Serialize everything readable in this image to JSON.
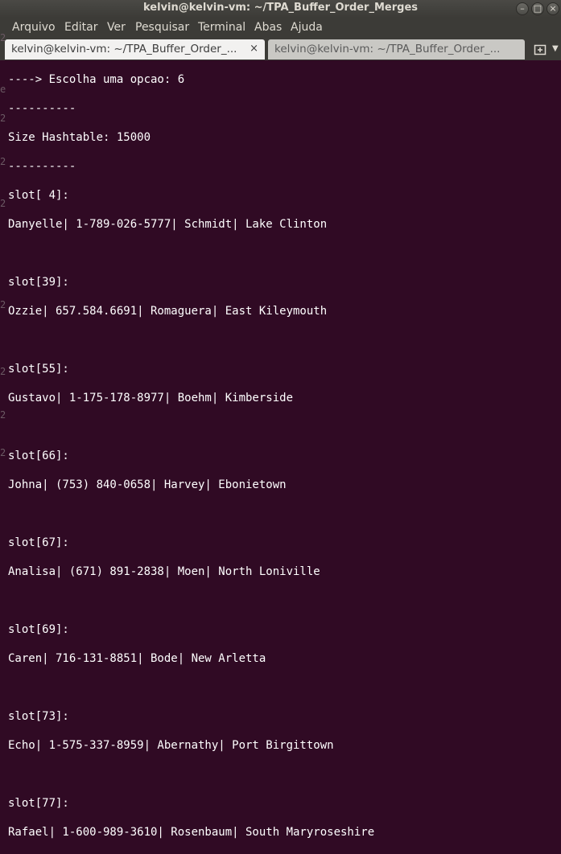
{
  "window": {
    "title": "kelvin@kelvin-vm: ~/TPA_Buffer_Order_Merges",
    "minimize_glyph": "–",
    "maximize_glyph": "□",
    "close_glyph": "×"
  },
  "menu": [
    "Arquivo",
    "Editar",
    "Ver",
    "Pesquisar",
    "Terminal",
    "Abas",
    "Ajuda"
  ],
  "tabs": [
    {
      "label": "kelvin@kelvin-vm: ~/TPA_Buffer_Order_...",
      "close": "×"
    },
    {
      "label": "kelvin@kelvin-vm: ~/TPA_Buffer_Order_..."
    }
  ],
  "new_tab_icon": "new-tab-icon",
  "terminal_lines": [
    "----> Escolha uma opcao: 6",
    "----------",
    "Size Hashtable: 15000",
    "----------",
    "slot[ 4]:",
    "Danyelle| 1-789-026-5777| Schmidt| Lake Clinton",
    "",
    "slot[39]:",
    "Ozzie| 657.584.6691| Romaguera| East Kileymouth",
    "",
    "slot[55]:",
    "Gustavo| 1-175-178-8977| Boehm| Kimberside",
    "",
    "slot[66]:",
    "Johna| (753) 840-0658| Harvey| Ebonietown",
    "",
    "slot[67]:",
    "Analisa| (671) 891-2838| Moen| North Loniville",
    "",
    "slot[69]:",
    "Caren| 716-131-8851| Bode| New Arletta",
    "",
    "slot[73]:",
    "Echo| 1-575-337-8959| Abernathy| Port Birgittown",
    "",
    "slot[77]:",
    "Rafael| 1-600-989-3610| Rosenbaum| South Maryroseshire"
  ],
  "gutter_marks": [
    "2",
    "e",
    "2",
    "2",
    "2",
    "2",
    "2",
    "2",
    "2"
  ]
}
